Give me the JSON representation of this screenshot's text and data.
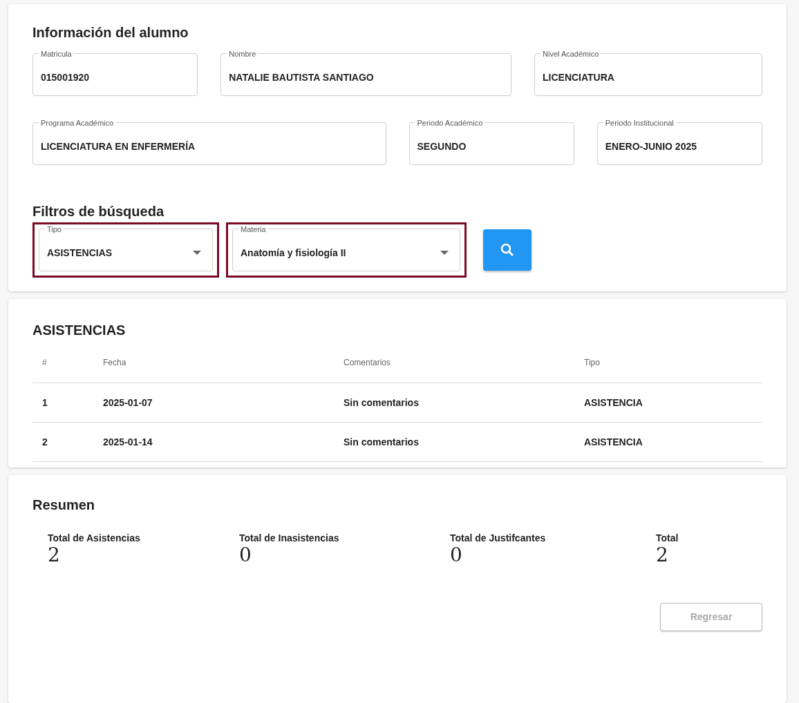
{
  "student_info": {
    "title": "Información del alumno",
    "fields": [
      {
        "label": "Matricula",
        "value": "015001920"
      },
      {
        "label": "Nombre",
        "value": "NATALIE BAUTISTA SANTIAGO"
      },
      {
        "label": "Nivel Académico",
        "value": "LICENCIATURA"
      },
      {
        "label": "Programa Académico",
        "value": "LICENCIATURA EN ENFERMERÍA"
      },
      {
        "label": "Periodo Académico",
        "value": "SEGUNDO"
      },
      {
        "label": "Periodo Institucional",
        "value": "ENERO-JUNIO 2025"
      }
    ]
  },
  "filters": {
    "title": "Filtros de búsqueda",
    "selects": [
      {
        "label": "Tipo",
        "value": "ASISTENCIAS",
        "highlighted": true
      },
      {
        "label": "Materia",
        "value": "Anatomía y fisiología II",
        "highlighted": true
      }
    ]
  },
  "attendance": {
    "title": "ASISTENCIAS",
    "columns": [
      "#",
      "Fecha",
      "Comentarios",
      "Tipo"
    ],
    "rows": [
      [
        "1",
        "2025-01-07",
        "Sin comentarios",
        "ASISTENCIA"
      ],
      [
        "2",
        "2025-01-14",
        "Sin comentarios",
        "ASISTENCIA"
      ]
    ]
  },
  "summary": {
    "title": "Resumen",
    "stats": [
      {
        "label": "Total de Asistencias",
        "value": "2"
      },
      {
        "label": "Total de Inasistencias",
        "value": "0"
      },
      {
        "label": "Total de Justifcantes",
        "value": "0"
      },
      {
        "label": "Total",
        "value": "2"
      }
    ],
    "back_button": {
      "label": "Regresar",
      "disabled": true
    }
  }
}
